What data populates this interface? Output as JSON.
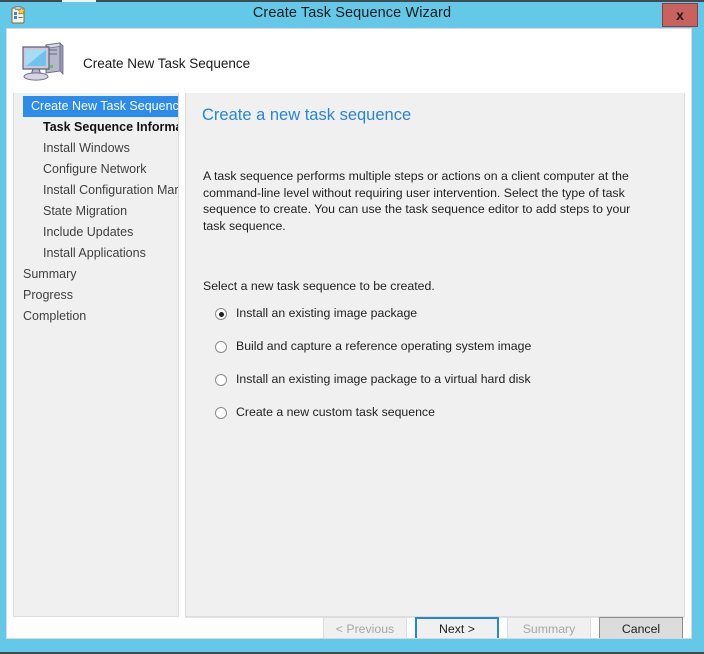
{
  "window": {
    "title": "Create Task Sequence Wizard",
    "title_icon": "task-list-clipboard-icon",
    "close_label": "x",
    "titlebar_color": "#64c8e8"
  },
  "banner": {
    "icon": "computer-icon",
    "title": "Create New Task Sequence"
  },
  "sidebar": {
    "items": [
      {
        "label": "Create New Task Sequence",
        "state": "selected",
        "indent": false
      },
      {
        "label": "Task Sequence Informati",
        "state": "current",
        "indent": true
      },
      {
        "label": "Install Windows",
        "state": "normal",
        "indent": true
      },
      {
        "label": "Configure Network",
        "state": "normal",
        "indent": true
      },
      {
        "label": "Install Configuration Mar",
        "state": "normal",
        "indent": true
      },
      {
        "label": "State Migration",
        "state": "normal",
        "indent": true
      },
      {
        "label": "Include Updates",
        "state": "normal",
        "indent": true
      },
      {
        "label": "Install Applications",
        "state": "normal",
        "indent": true
      },
      {
        "label": "Summary",
        "state": "normal",
        "indent": false
      },
      {
        "label": "Progress",
        "state": "normal",
        "indent": false
      },
      {
        "label": "Completion",
        "state": "normal",
        "indent": false
      }
    ],
    "selected_color": "#2b8ceb",
    "scrollbar": {
      "left_arrow": "‹",
      "right_arrow": "›",
      "thumb_grip": "III"
    }
  },
  "content": {
    "heading": "Create a new task sequence",
    "heading_color": "#2686d6",
    "description": "A task sequence performs multiple steps or actions on a client computer at the command-line level without requiring user intervention. Select the type of task sequence to create. You can use the task sequence editor to add steps to your task sequence.",
    "options_label": "Select a new task sequence to be created.",
    "options": [
      {
        "label": "Install an existing image package",
        "checked": true
      },
      {
        "label": "Build and capture a reference operating system image",
        "checked": false
      },
      {
        "label": "Install an existing image package to a virtual hard disk",
        "checked": false
      },
      {
        "label": "Create a new custom task sequence",
        "checked": false
      }
    ]
  },
  "footer": {
    "buttons": [
      {
        "label": "< Previous",
        "state": "disabled"
      },
      {
        "label": "Next >",
        "state": "focused"
      },
      {
        "label": "Summary",
        "state": "disabled"
      },
      {
        "label": "Cancel",
        "state": "strong"
      }
    ]
  }
}
